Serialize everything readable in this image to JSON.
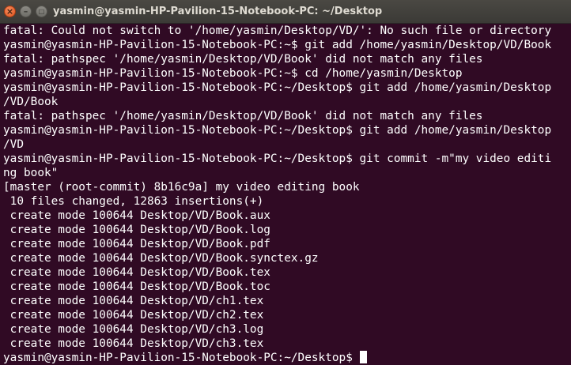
{
  "window": {
    "title": "yasmin@yasmin-HP-Pavilion-15-Notebook-PC: ~/Desktop",
    "close_glyph": "×",
    "minimize_glyph": "–",
    "maximize_glyph": "□"
  },
  "terminal": {
    "lines": [
      "fatal: Could not switch to '/home/yasmin/Desktop/VD/': No such file or directory",
      "yasmin@yasmin-HP-Pavilion-15-Notebook-PC:~$ git add /home/yasmin/Desktop/VD/Book",
      "fatal: pathspec '/home/yasmin/Desktop/VD/Book' did not match any files",
      "yasmin@yasmin-HP-Pavilion-15-Notebook-PC:~$ cd /home/yasmin/Desktop",
      "yasmin@yasmin-HP-Pavilion-15-Notebook-PC:~/Desktop$ git add /home/yasmin/Desktop",
      "/VD/Book",
      "fatal: pathspec '/home/yasmin/Desktop/VD/Book' did not match any files",
      "yasmin@yasmin-HP-Pavilion-15-Notebook-PC:~/Desktop$ git add /home/yasmin/Desktop",
      "/VD",
      "yasmin@yasmin-HP-Pavilion-15-Notebook-PC:~/Desktop$ git commit -m\"my video editi",
      "ng book\"",
      "[master (root-commit) 8b16c9a] my video editing book",
      " 10 files changed, 12863 insertions(+)",
      " create mode 100644 Desktop/VD/Book.aux",
      " create mode 100644 Desktop/VD/Book.log",
      " create mode 100644 Desktop/VD/Book.pdf",
      " create mode 100644 Desktop/VD/Book.synctex.gz",
      " create mode 100644 Desktop/VD/Book.tex",
      " create mode 100644 Desktop/VD/Book.toc",
      " create mode 100644 Desktop/VD/ch1.tex",
      " create mode 100644 Desktop/VD/ch2.tex",
      " create mode 100644 Desktop/VD/ch3.log",
      " create mode 100644 Desktop/VD/ch3.tex"
    ],
    "prompt": "yasmin@yasmin-HP-Pavilion-15-Notebook-PC:~/Desktop$ "
  },
  "colors": {
    "background": "#300a24",
    "text": "#ffffff",
    "close_button": "#e95420"
  }
}
